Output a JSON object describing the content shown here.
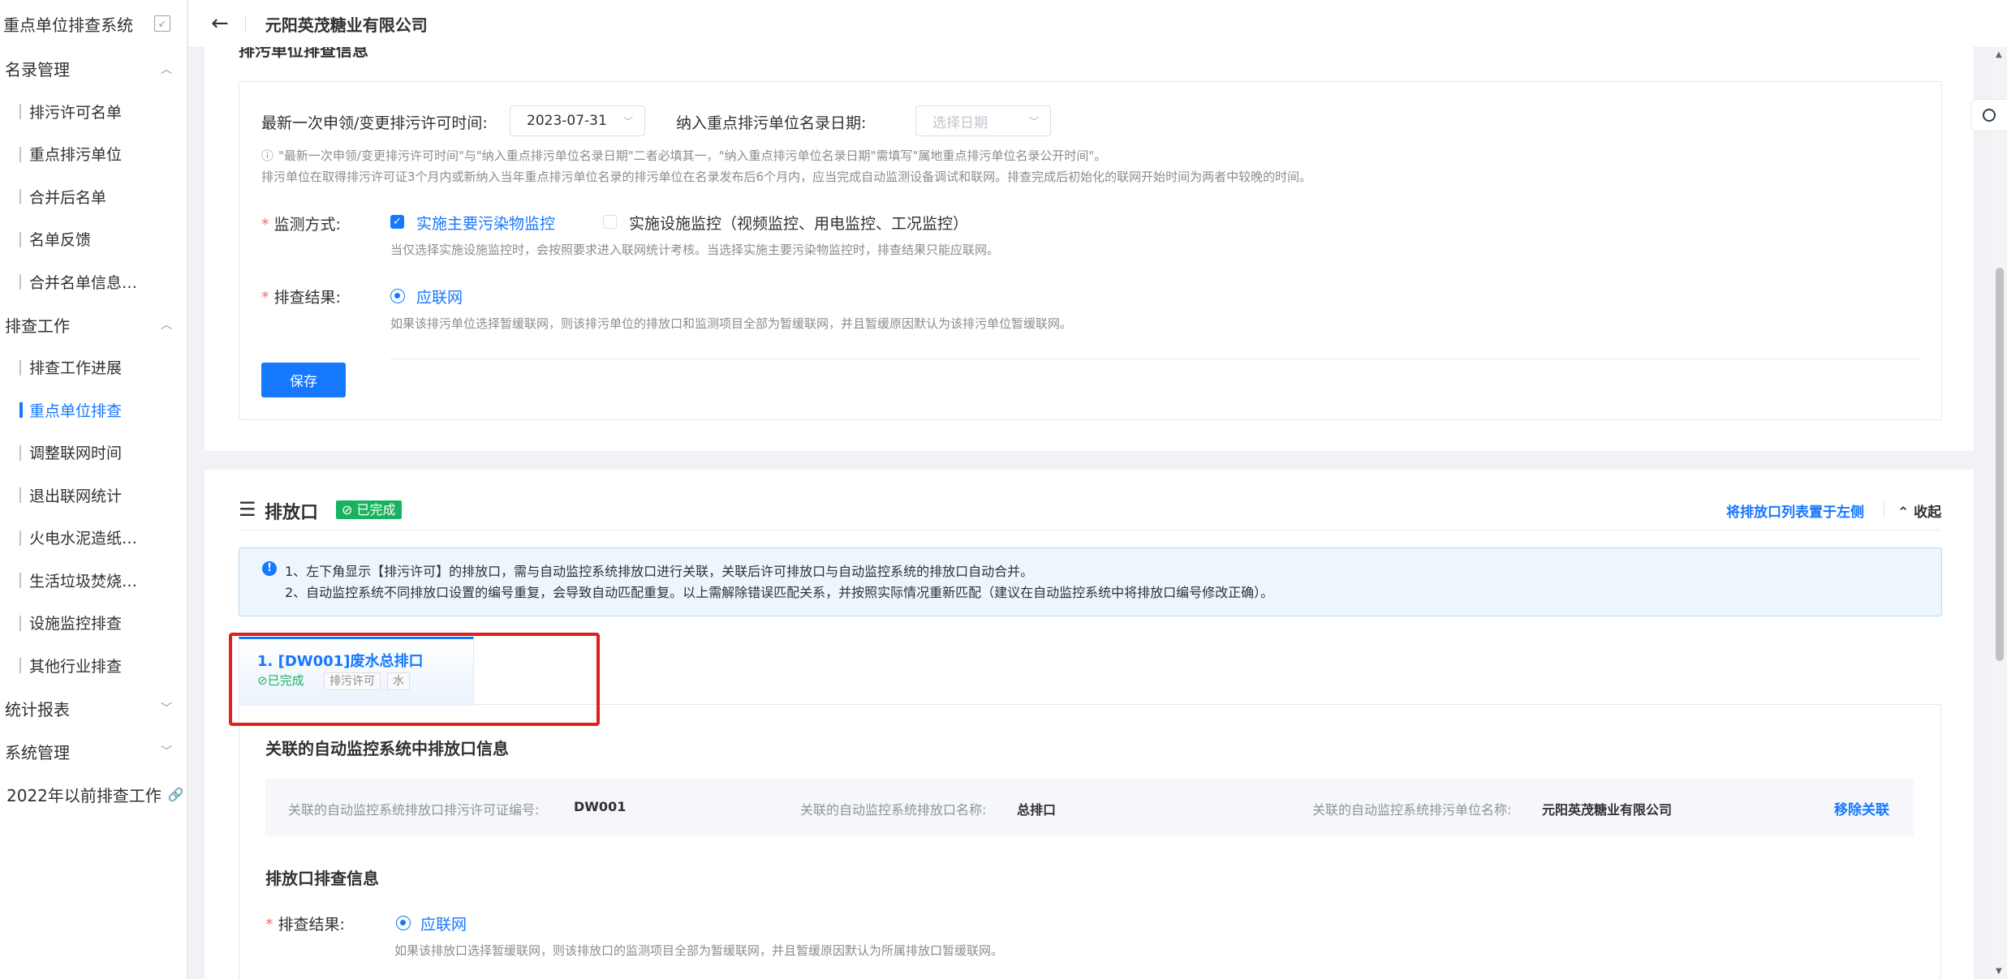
{
  "app": {
    "title": "重点单位排查系统"
  },
  "sidebar": {
    "groups": [
      {
        "label": "名录管理",
        "items": [
          "排污许可名单",
          "重点排污单位",
          "合并后名单",
          "名单反馈",
          "合并名单信息…"
        ]
      },
      {
        "label": "排查工作",
        "items": [
          "排查工作进展",
          "重点单位排查",
          "调整联网时间",
          "退出联网统计",
          "火电水泥造纸…",
          "生活垃圾焚烧…",
          "设施监控排查",
          "其他行业排查"
        ]
      },
      {
        "label": "统计报表",
        "items": []
      },
      {
        "label": "系统管理",
        "items": []
      }
    ],
    "active_item": "重点单位排查",
    "last_link": "2022年以前排查工作"
  },
  "header": {
    "company": "元阳英茂糖业有限公司"
  },
  "top_section": {
    "cut_title": "排污单位排查信息",
    "permit_time_label": "最新一次申领/变更排污许可时间:",
    "permit_time_value": "2023-07-31",
    "key_unit_date_label": "纳入重点排污单位名录日期:",
    "key_unit_date_placeholder": "选择日期",
    "hint_line1": "\"最新一次申领/变更排污许可时间\"与\"纳入重点排污单位名录日期\"二者必填其一，\"纳入重点排污单位名录日期\"需填写\"属地重点排污单位名录公开时间\"。",
    "hint_line2": "排污单位在取得排污许可证3个月内或新纳入当年重点排污单位名录的排污单位在名录发布后6个月内，应当完成自动监测设备调试和联网。排查完成后初始化的联网开始时间为两者中较晚的时间。",
    "monitor_label": "监测方式:",
    "monitor_option1": "实施主要污染物监控",
    "monitor_option2": "实施设施监控（视频监控、用电监控、工况监控）",
    "monitor_hint": "当仅选择实施设施监控时，会按照要求进入联网统计考核。当选择实施主要污染物监控时，排查结果只能应联网。",
    "result_label": "排查结果:",
    "result_option": "应联网",
    "result_hint": "如果该排污单位选择暂缓联网，则该排污单位的排放口和监测项目全部为暂缓联网，并且暂缓原因默认为该排污单位暂缓联网。",
    "save_button": "保存"
  },
  "outlet_section": {
    "title": "排放口",
    "status": "已完成",
    "move_left_link": "将排放口列表置于左侧",
    "collapse_link": "收起",
    "notice_line1": "1、左下角显示【排污许可】的排放口，需与自动监控系统排放口进行关联，关联后许可排放口与自动监控系统的排放口自动合并。",
    "notice_line2": "2、自动监控系统不同排放口设置的编号重复，会导致自动匹配重复。以上需解除错误匹配关系，并按照实际情况重新匹配（建议在自动监控系统中将排放口编号修改正确）。",
    "tab": {
      "title": "1. [DW001]废水总排口",
      "status": "已完成",
      "tag1": "排污许可",
      "tag2": "水"
    },
    "linked_title": "关联的自动监控系统中排放口信息",
    "linked_permit_label": "关联的自动监控系统排放口排污许可证编号:",
    "linked_permit_value": "DW001",
    "linked_name_label": "关联的自动监控系统排放口名称:",
    "linked_name_value": "总排口",
    "linked_unit_label": "关联的自动监控系统排污单位名称:",
    "linked_unit_value": "元阳英茂糖业有限公司",
    "remove_link": "移除关联",
    "check_title": "排放口排查信息",
    "check_result_label": "排查结果:",
    "check_result_option": "应联网",
    "check_result_hint": "如果该排放口选择暂缓联网，则该排放口的监测项目全部为暂缓联网，并且暂缓原因默认为所属排放口暂缓联网。"
  }
}
